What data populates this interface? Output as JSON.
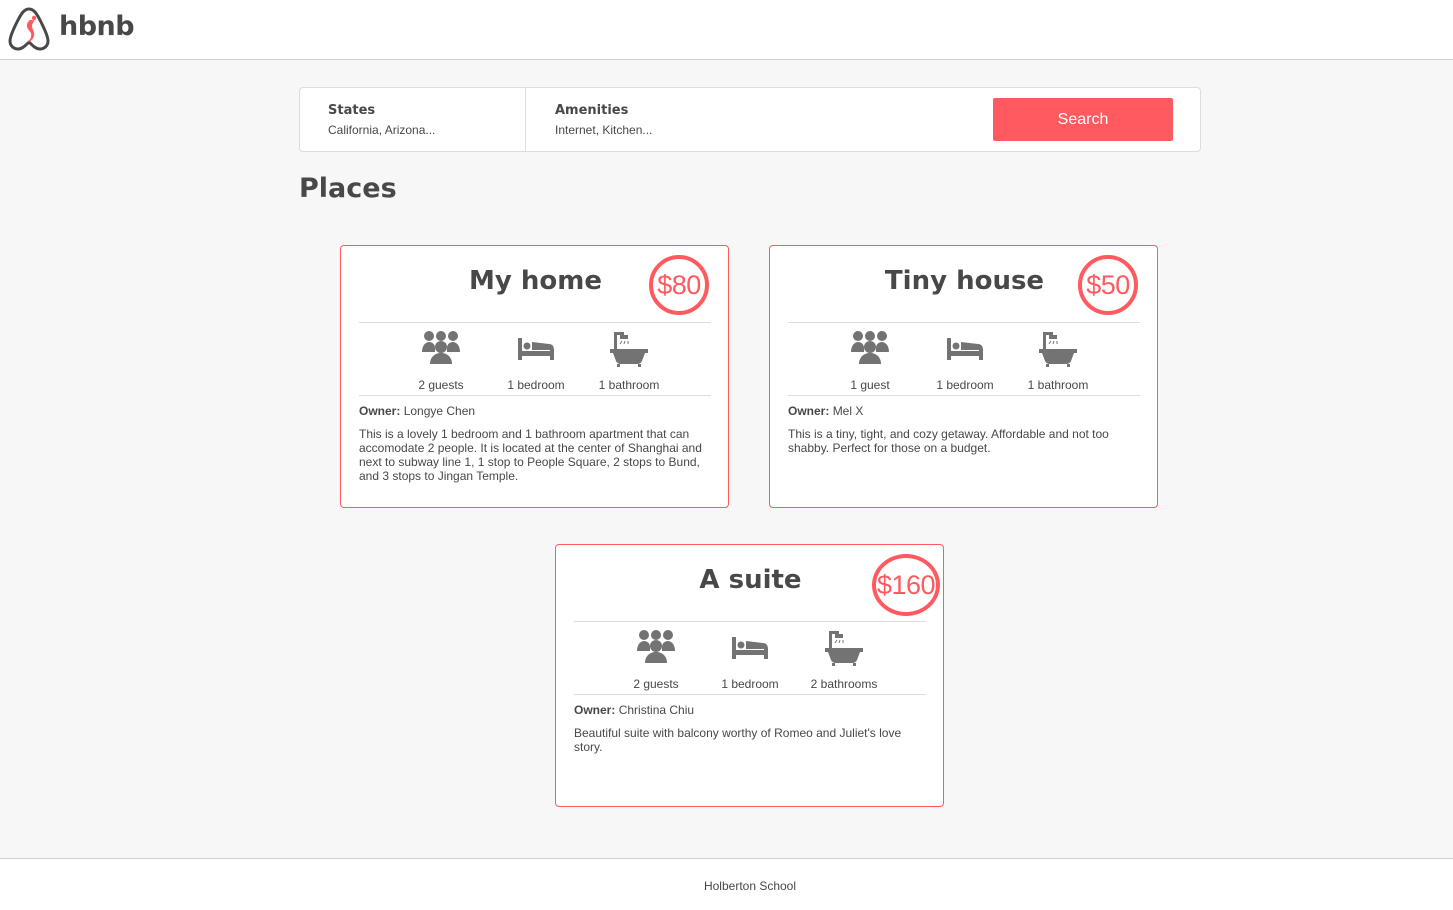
{
  "header": {
    "brand": "hbnb",
    "brand_color": "#ff5a5f"
  },
  "filters": {
    "states": {
      "title": "States",
      "value": "California, Arizona..."
    },
    "amenities": {
      "title": "Amenities",
      "value": "Internet, Kitchen..."
    },
    "search_label": "Search"
  },
  "places_title": "Places",
  "places": [
    {
      "name": "My home",
      "price": "$80",
      "guests": "2 guests",
      "bedrooms": "1 bedroom",
      "bathrooms": "1 bathroom",
      "owner_label": "Owner:",
      "owner": "Longye Chen",
      "description": "This is a lovely 1 bedroom and 1 bathroom apartment that can accomodate 2 people. It is located at the center of Shanghai and next to subway line 1, 1 stop to People Square, 2 stops to Bund, and 3 stops to Jingan Temple."
    },
    {
      "name": "Tiny house",
      "price": "$50",
      "guests": "1 guest",
      "bedrooms": "1 bedroom",
      "bathrooms": "1 bathroom",
      "owner_label": "Owner:",
      "owner": "Mel X",
      "description": "This is a tiny, tight, and cozy getaway. Affordable and not too shabby. Perfect for those on a budget."
    },
    {
      "name": "A suite",
      "price": "$160",
      "guests": "2 guests",
      "bedrooms": "1 bedroom",
      "bathrooms": "2 bathrooms",
      "owner_label": "Owner:",
      "owner": "Christina Chiu",
      "description": "Beautiful suite with balcony worthy of Romeo and Juliet's love story."
    }
  ],
  "icons": {
    "guests": "group-icon",
    "bedrooms": "bed-icon",
    "bathrooms": "bathtub-icon",
    "logo": "hbnb-logo-icon"
  },
  "footer": {
    "text": "Holberton School"
  },
  "colors": {
    "accent": "#ff5a5f",
    "text": "#484848",
    "icon": "#737373"
  }
}
